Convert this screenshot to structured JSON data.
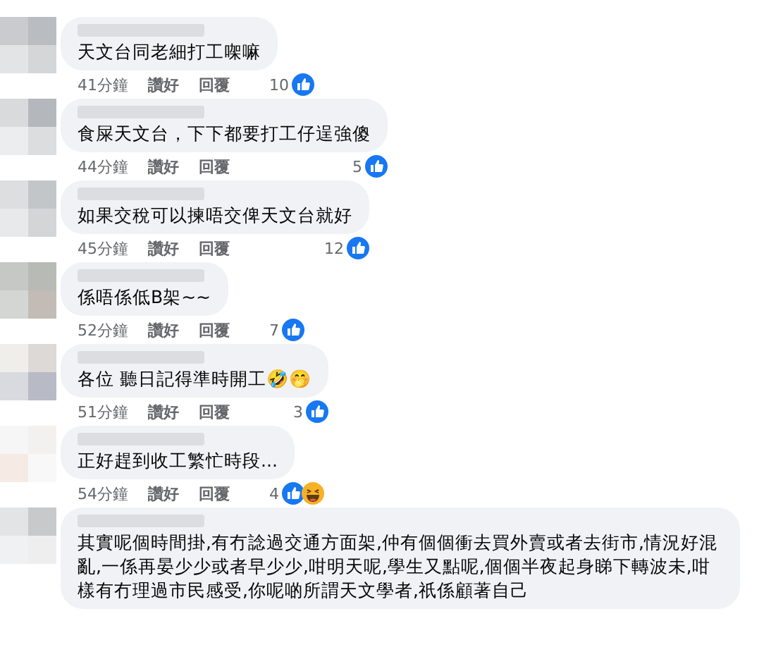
{
  "comments": [
    {
      "text": "天文台同老細打工㗎嘛",
      "time": "41分鐘",
      "like_label": "讚好",
      "reply_label": "回覆",
      "reaction_count": "10",
      "reactions": [
        {
          "kind": "like"
        }
      ]
    },
    {
      "text": "食屎天文台，下下都要打工仔逞強傻",
      "time": "44分鐘",
      "like_label": "讚好",
      "reply_label": "回覆",
      "reaction_count": "5",
      "reactions": [
        {
          "kind": "like"
        }
      ]
    },
    {
      "text": "如果交稅可以揀唔交俾天文台就好",
      "time": "45分鐘",
      "like_label": "讚好",
      "reply_label": "回覆",
      "reaction_count": "12",
      "reactions": [
        {
          "kind": "like"
        }
      ]
    },
    {
      "text": "係唔係低B架~~",
      "time": "52分鐘",
      "like_label": "讚好",
      "reply_label": "回覆",
      "reaction_count": "7",
      "reactions": [
        {
          "kind": "like"
        }
      ]
    },
    {
      "text": "各位 聽日記得準時開工🤣🤭",
      "time": "51分鐘",
      "like_label": "讚好",
      "reply_label": "回覆",
      "reaction_count": "3",
      "reactions": [
        {
          "kind": "like"
        }
      ]
    },
    {
      "text": "正好趕到收工繁忙時段...",
      "time": "54分鐘",
      "like_label": "讚好",
      "reply_label": "回覆",
      "reaction_count": "4",
      "reactions": [
        {
          "kind": "like"
        },
        {
          "kind": "haha"
        }
      ]
    },
    {
      "text": "其實呢個時間掛,有冇諗過交通方面架,仲有個個衝去買外賣或者去街市,情況好混亂,一係再晏少少或者早少少,咁明天呢,學生又點呢,個個半夜起身睇下轉波未,咁樣有冇理過市民感受,你呢啲所謂天文學者,祇係顧著自己"
    }
  ]
}
